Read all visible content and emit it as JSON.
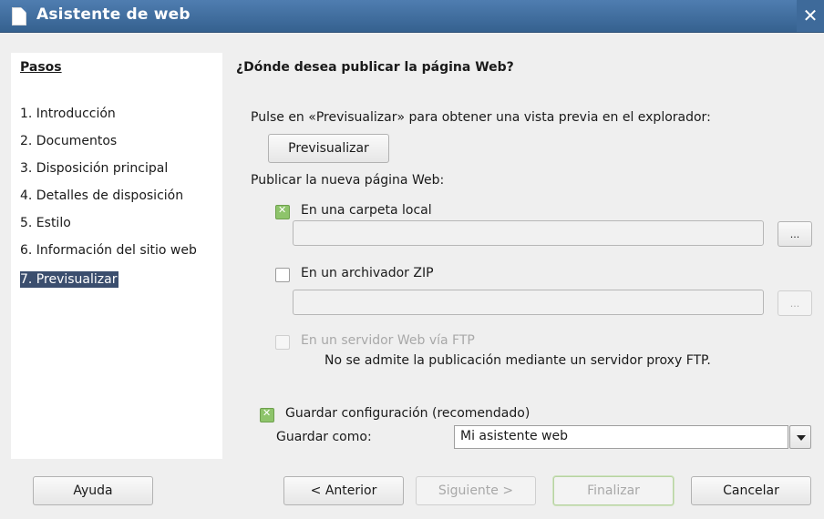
{
  "window": {
    "title": "Asistente de web",
    "close_glyph": "✕"
  },
  "sidebar": {
    "heading": "Pasos",
    "steps": [
      "1. Introducción",
      "2. Documentos",
      "3. Disposición principal",
      "4. Detalles de disposición",
      "5. Estilo",
      "6. Información del sitio web",
      "7. Previsualizar"
    ],
    "active_step_index": 6
  },
  "main": {
    "title": "¿Dónde desea publicar la página Web?",
    "preview_hint": "Pulse en «Previsualizar» para obtener una vista previa en el explorador:",
    "preview_button": "Previsualizar",
    "publish_label": "Publicar la nueva página Web:",
    "local_folder": {
      "label": "En una carpeta local",
      "checked": true,
      "value": "",
      "browse": "..."
    },
    "zip_archive": {
      "label": "En un archivador ZIP",
      "checked": false,
      "value": "",
      "browse": "..."
    },
    "ftp_server": {
      "label": "En un servidor Web vía FTP",
      "checked": false,
      "enabled": false,
      "note": "No se admite la publicación mediante un servidor proxy FTP."
    },
    "save_settings": {
      "label": "Guardar configuración (recomendado)",
      "checked": true,
      "save_as_label": "Guardar como:",
      "save_as_value": "Mi asistente web"
    }
  },
  "buttons": {
    "help": "Ayuda",
    "back": "< Anterior",
    "next": "Siguiente >",
    "finish": "Finalizar",
    "cancel": "Cancelar"
  },
  "colors": {
    "titlebar": "#3f6c9e",
    "active_step": "#3b4e6e",
    "checkbox_checked": "#8ec46b"
  }
}
